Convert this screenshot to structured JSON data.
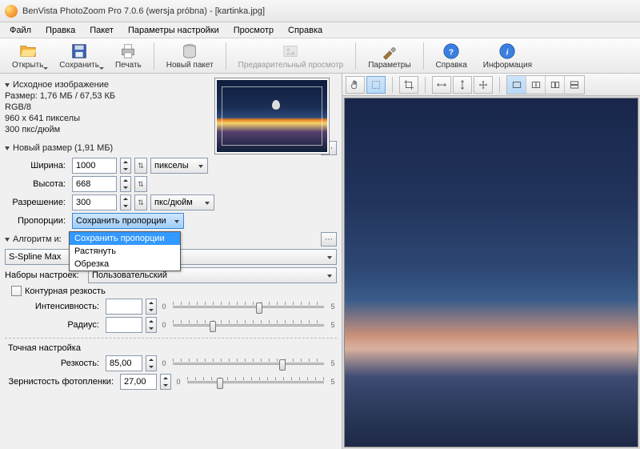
{
  "window": {
    "title": "BenVista PhotoZoom Pro 7.0.6 (wersja próbna) - [kartinka.jpg]"
  },
  "menu": [
    "Файл",
    "Правка",
    "Пакет",
    "Параметры настройки",
    "Просмотр",
    "Справка"
  ],
  "toolbar": {
    "open": "Открыть",
    "save": "Сохранить",
    "print": "Печать",
    "batch": "Новый пакет",
    "preview": "Предварительный просмотр",
    "params": "Параметры",
    "help": "Справка",
    "info": "Информация"
  },
  "source": {
    "header": "Исходное изображение",
    "size": "Размер: 1,76 МБ / 67,53 КБ",
    "mode": "RGB/8",
    "dims": "960 x 641 пикселы",
    "dpi": "300 пкс/дюйм"
  },
  "newsize": {
    "header": "Новый размер (1,91 МБ)",
    "width_lbl": "Ширина:",
    "width": "1000",
    "height_lbl": "Высота:",
    "height": "668",
    "unit_px": "пикселы",
    "res_lbl": "Разрешение:",
    "res": "300",
    "unit_dpi": "пкс/дюйм",
    "ratio_lbl": "Пропорции:",
    "ratio_sel": "Сохранить пропорции",
    "ratio_opts": [
      "Сохранить пропорции",
      "Растянуть",
      "Обрезка"
    ]
  },
  "algo": {
    "header": "Алгоритм изменения размеров",
    "method": "S-Spline Max",
    "preset_lbl": "Наборы настроек:",
    "preset": "Пользовательский",
    "edge_cb": "Контурная резкость",
    "intensity_lbl": "Интенсивность:",
    "intensity": "",
    "radius_lbl": "Радиус:",
    "radius": ""
  },
  "fine": {
    "header": "Точная настройка",
    "sharp_lbl": "Резкость:",
    "sharp": "85,00",
    "grain_lbl": "Зернистость фотопленки:",
    "grain": "27,00"
  },
  "slider": {
    "min": "0",
    "max": "5"
  }
}
